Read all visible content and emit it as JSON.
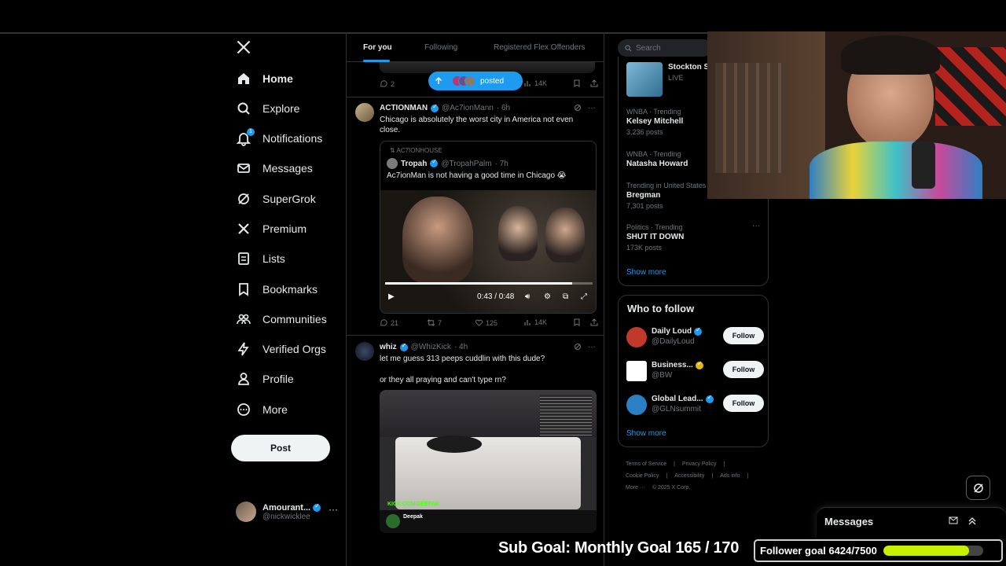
{
  "nav": {
    "items": [
      {
        "label": "Home",
        "icon": "home-icon"
      },
      {
        "label": "Explore",
        "icon": "search-icon"
      },
      {
        "label": "Notifications",
        "icon": "bell-icon",
        "badge": "1"
      },
      {
        "label": "Messages",
        "icon": "mail-icon"
      },
      {
        "label": "SuperGrok",
        "icon": "grok-icon"
      },
      {
        "label": "Premium",
        "icon": "x-icon"
      },
      {
        "label": "Lists",
        "icon": "list-icon"
      },
      {
        "label": "Bookmarks",
        "icon": "bookmark-icon"
      },
      {
        "label": "Communities",
        "icon": "people-icon"
      },
      {
        "label": "Verified Orgs",
        "icon": "lightning-icon"
      },
      {
        "label": "Profile",
        "icon": "person-icon"
      },
      {
        "label": "More",
        "icon": "more-circle-icon"
      }
    ],
    "post_label": "Post",
    "account": {
      "name": "Amourant...",
      "handle": "@nickwicklee"
    }
  },
  "tabs": [
    "For you",
    "Following",
    "Registered Flex Offenders"
  ],
  "prev_tweet": {
    "replies": "2",
    "views": "14K"
  },
  "posted_pill": "posted",
  "tweets": [
    {
      "name": "ACTIONMAN",
      "handle": "@Ac7ionMann",
      "time": "· 6h",
      "text": "Chicago is absolutely the worst city in America not even close.",
      "quote": {
        "repost_label": "AC7IONHOUSE",
        "name": "Tropah",
        "handle": "@TropahPalm",
        "time": "· 7h",
        "text": "Ac7ionMan is not having a good time in Chicago 😭",
        "video_time": "0:43 / 0:48",
        "video_progress": 0.9
      },
      "replies": "21",
      "reposts": "7",
      "likes": "125",
      "views": "14K"
    },
    {
      "name": "whiz",
      "handle": "@WhizKick",
      "time": "· 4h",
      "text": "let me guess 313 peeps cuddlin with this dude?",
      "text2": "or they all praying and can't type rn?",
      "image_caption": "KICK.COM/DEEPAK",
      "image_title": "Deepak"
    }
  ],
  "search": {
    "placeholder": "Search"
  },
  "live": {
    "name": "Stockton S",
    "status": "LIVE"
  },
  "trends": [
    {
      "category": "WNBA · Trending",
      "name": "Kelsey Mitchell",
      "count": "3,236 posts"
    },
    {
      "category": "WNBA · Trending",
      "name": "Natasha Howard",
      "count": ""
    },
    {
      "category": "Trending in United States",
      "name": "Bregman",
      "count": "7,301 posts"
    },
    {
      "category": "Politics · Trending",
      "name": "SHUT IT DOWN",
      "count": "173K posts"
    }
  ],
  "show_more": "Show more",
  "who_to_follow": {
    "title": "Who to follow",
    "accounts": [
      {
        "name": "Daily Loud",
        "handle": "@DailyLoud",
        "color": "#c0392b"
      },
      {
        "name": "Business...",
        "handle": "@BW",
        "color": "#ffffff"
      },
      {
        "name": "Global Lead...",
        "handle": "@GLNsummit",
        "color": "#2b7fc4"
      }
    ],
    "follow_label": "Follow",
    "show_more": "Show more"
  },
  "footer": [
    "Terms of Service",
    "|",
    "Privacy Policy",
    "|",
    "Cookie Policy",
    "|",
    "Accessibility",
    "|",
    "Ads info",
    "|",
    "More ···",
    "© 2025 X Corp."
  ],
  "messages_dock": {
    "title": "Messages"
  },
  "overlay": {
    "sub_goal": "Sub Goal: Monthly Goal  165 / 170",
    "follower_goal": "Follower goal 6424/7500",
    "follower_progress": 0.8565
  },
  "colors": {
    "accent": "#1d9bf0",
    "background": "#000000",
    "goal_bar": "#c7f000"
  }
}
